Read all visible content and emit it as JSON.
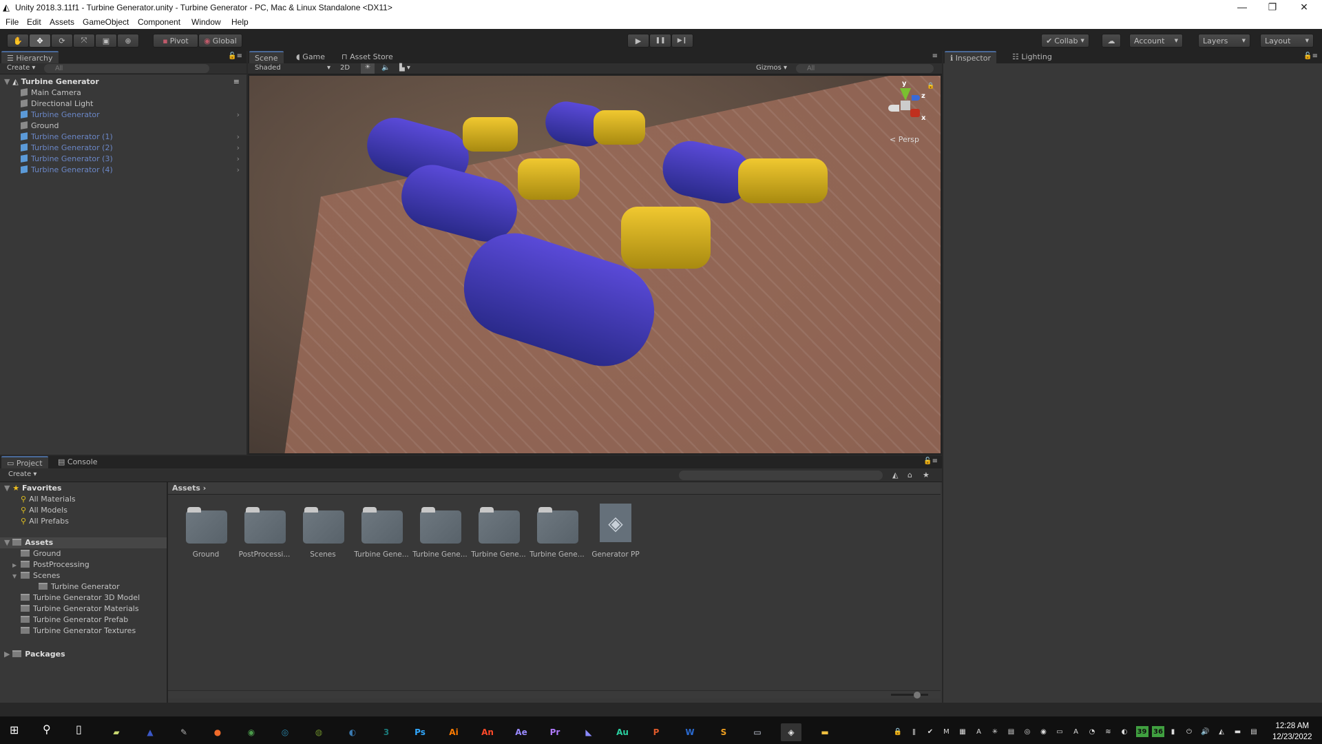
{
  "window": {
    "title": "Unity 2018.3.11f1 - Turbine Generator.unity - Turbine Generator - PC, Mac & Linux Standalone <DX11>",
    "controls": {
      "minimize": "—",
      "restore": "❐",
      "close": "✕"
    }
  },
  "menu": [
    "File",
    "Edit",
    "Assets",
    "GameObject",
    "Component",
    "Window",
    "Help"
  ],
  "toolbar": {
    "tools": [
      {
        "name": "hand-tool",
        "glyph": "✋"
      },
      {
        "name": "move-tool",
        "glyph": "✥"
      },
      {
        "name": "rotate-tool",
        "glyph": "⟳"
      },
      {
        "name": "scale-tool",
        "glyph": "⤧"
      },
      {
        "name": "rect-tool",
        "glyph": "▣"
      },
      {
        "name": "transform-tool",
        "glyph": "⊕"
      }
    ],
    "pivot": "Pivot",
    "global": "Global",
    "play": "▶",
    "pause": "❚❚",
    "step": "▶❙",
    "collab": "Collab",
    "cloud": "☁",
    "account": "Account",
    "layers": "Layers",
    "layout": "Layout"
  },
  "hierarchy": {
    "tab": "Hierarchy",
    "create": "Create",
    "search_placeholder": "All",
    "scene": "Turbine Generator",
    "items": [
      {
        "label": "Main Camera",
        "prefab": false
      },
      {
        "label": "Directional Light",
        "prefab": false
      },
      {
        "label": "Turbine Generator",
        "prefab": true
      },
      {
        "label": "Ground",
        "prefab": false
      },
      {
        "label": "Turbine Generator (1)",
        "prefab": true
      },
      {
        "label": "Turbine Generator (2)",
        "prefab": true
      },
      {
        "label": "Turbine Generator (3)",
        "prefab": true
      },
      {
        "label": "Turbine Generator (4)",
        "prefab": true
      }
    ]
  },
  "scene_view": {
    "tabs": [
      "Scene",
      "Game",
      "Asset Store"
    ],
    "shading": "Shaded",
    "mode_2d": "2D",
    "gizmos": "Gizmos",
    "search_placeholder": "All",
    "projection": "Persp",
    "axes": {
      "x": "x",
      "y": "y",
      "z": "z"
    }
  },
  "inspector": {
    "tabs": [
      "Inspector",
      "Lighting"
    ]
  },
  "project": {
    "tabs": [
      "Project",
      "Console"
    ],
    "create": "Create",
    "favorites_label": "Favorites",
    "favorites": [
      "All Materials",
      "All Models",
      "All Prefabs"
    ],
    "assets_label": "Assets",
    "tree": [
      {
        "label": "Ground",
        "depth": 1,
        "arrow": ""
      },
      {
        "label": "PostProcessing",
        "depth": 1,
        "arrow": "▶"
      },
      {
        "label": "Scenes",
        "depth": 1,
        "arrow": "▼"
      },
      {
        "label": "Turbine Generator",
        "depth": 2,
        "arrow": ""
      },
      {
        "label": "Turbine Generator 3D Model",
        "depth": 1,
        "arrow": ""
      },
      {
        "label": "Turbine Generator Materials",
        "depth": 1,
        "arrow": ""
      },
      {
        "label": "Turbine Generator Prefab",
        "depth": 1,
        "arrow": ""
      },
      {
        "label": "Turbine Generator Textures",
        "depth": 1,
        "arrow": ""
      }
    ],
    "packages_label": "Packages",
    "breadcrumb": "Assets",
    "grid": [
      "Ground",
      "PostProcessi...",
      "Scenes",
      "Turbine Gene...",
      "Turbine Gene...",
      "Turbine Gene...",
      "Turbine Gene...",
      "Generator PP"
    ]
  },
  "taskbar": {
    "apps": [
      {
        "name": "file-explorer",
        "glyph": "▰",
        "color": "#c8d870"
      },
      {
        "name": "scanner-app",
        "glyph": "▲",
        "color": "#3a58c8"
      },
      {
        "name": "paint-app",
        "glyph": "✎",
        "color": "#b0b0b0"
      },
      {
        "name": "firefox",
        "glyph": "●",
        "color": "#f06b2a"
      },
      {
        "name": "chrome",
        "glyph": "◉",
        "color": "#4a9a4a"
      },
      {
        "name": "search-app",
        "glyph": "◎",
        "color": "#2a8ab0"
      },
      {
        "name": "globe-app",
        "glyph": "◍",
        "color": "#6a8a2a"
      },
      {
        "name": "earth-app",
        "glyph": "◐",
        "color": "#3a7ab0"
      },
      {
        "name": "3ds-app",
        "glyph": "3",
        "color": "#1a7a7a"
      },
      {
        "name": "photoshop",
        "glyph": "Ps",
        "color": "#31a8ff"
      },
      {
        "name": "illustrator",
        "glyph": "Ai",
        "color": "#ff7c00"
      },
      {
        "name": "animate",
        "glyph": "An",
        "color": "#ff4a2a"
      },
      {
        "name": "after-effects",
        "glyph": "Ae",
        "color": "#9a8aff"
      },
      {
        "name": "premiere",
        "glyph": "Pr",
        "color": "#b07aff"
      },
      {
        "name": "media-encoder",
        "glyph": "◣",
        "color": "#8a8aff"
      },
      {
        "name": "audition",
        "glyph": "Au",
        "color": "#2ad0a0"
      },
      {
        "name": "powerpoint",
        "glyph": "P",
        "color": "#e05a2a"
      },
      {
        "name": "word",
        "glyph": "W",
        "color": "#2a6ad0"
      },
      {
        "name": "sublime",
        "glyph": "S",
        "color": "#f0a020"
      },
      {
        "name": "remote-app",
        "glyph": "▭",
        "color": "#d0d8e8"
      },
      {
        "name": "unity",
        "glyph": "◈",
        "color": "#e8e8e8"
      },
      {
        "name": "folder-app",
        "glyph": "▬",
        "color": "#f0c040"
      }
    ],
    "tray": [
      "🔒",
      "ǁ",
      "✔",
      "M",
      "▦",
      "A",
      "✳",
      "▤",
      "◎",
      "◉",
      "▭",
      "A",
      "◔",
      "≋",
      "◐",
      "39",
      "36",
      "▮",
      "⏻",
      "🔊",
      "◭",
      "▬",
      "▤"
    ],
    "time": "12:28 AM",
    "date": "12/23/2022"
  }
}
